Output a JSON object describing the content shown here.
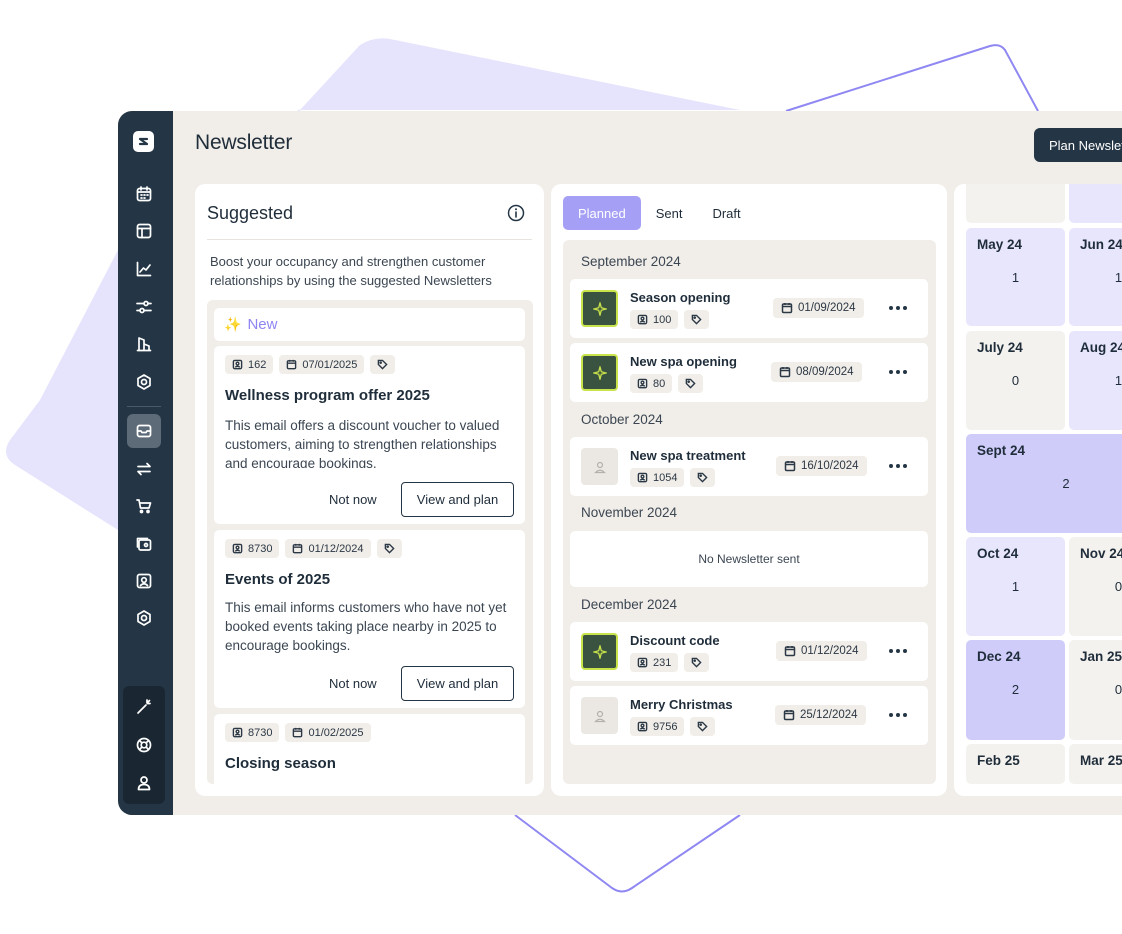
{
  "app": {
    "title": "Newsletter",
    "plan_button": "Plan Newsletter"
  },
  "sidebar": {
    "logo": "brand-logo-icon",
    "items": [
      {
        "icon": "calendar-icon",
        "active": false
      },
      {
        "icon": "layout-icon",
        "active": false
      },
      {
        "icon": "chart-icon",
        "active": false
      },
      {
        "icon": "sliders-icon",
        "active": false
      },
      {
        "icon": "building-icon",
        "active": false
      },
      {
        "icon": "settings-icon",
        "active": false
      },
      {
        "icon": "mail-icon",
        "active": true
      },
      {
        "icon": "transfer-icon",
        "active": false
      },
      {
        "icon": "cart-icon",
        "active": false
      },
      {
        "icon": "wallet-icon",
        "active": false
      },
      {
        "icon": "contact-icon",
        "active": false
      },
      {
        "icon": "gear-icon",
        "active": false
      }
    ],
    "bottom": [
      "magic-wand-icon",
      "lifebuoy-icon",
      "user-icon"
    ]
  },
  "suggested": {
    "title": "Suggested",
    "description": "Boost your occupancy and strengthen customer relationships by using the suggested Newsletters",
    "new_label": "New",
    "cards": [
      {
        "audience": "162",
        "date": "07/01/2025",
        "title": "Wellness program offer 2025",
        "description": "This email offers a discount voucher to valued customers, aiming to strengthen relationships and encourage bookings.",
        "dismiss": "Not now",
        "action": "View and plan"
      },
      {
        "audience": "8730",
        "date": "01/12/2024",
        "title": "Events of 2025",
        "description": "This email informs customers who have not yet booked events taking place nearby in 2025 to encourage bookings.",
        "dismiss": "Not now",
        "action": "View and plan"
      },
      {
        "audience": "8730",
        "date": "01/02/2025",
        "title": "Closing season"
      }
    ]
  },
  "planned": {
    "tabs": [
      "Planned",
      "Sent",
      "Draft"
    ],
    "active_tab": "Planned",
    "months": [
      {
        "label": "September 2024",
        "items": [
          {
            "title": "Season opening",
            "audience": "100",
            "date": "01/09/2024",
            "thumb": "spark"
          },
          {
            "title": "New spa opening",
            "audience": "80",
            "date": "08/09/2024",
            "thumb": "spark"
          }
        ]
      },
      {
        "label": "October 2024",
        "items": [
          {
            "title": "New spa treatment",
            "audience": "1054",
            "date": "16/10/2024",
            "thumb": "plain"
          }
        ]
      },
      {
        "label": "November 2024",
        "empty": "No Newsletter sent"
      },
      {
        "label": "December 2024",
        "items": [
          {
            "title": "Discount code",
            "audience": "231",
            "date": "01/12/2024",
            "thumb": "spark"
          },
          {
            "title": "Merry Christmas",
            "audience": "9756",
            "date": "25/12/2024",
            "thumb": "plain"
          }
        ]
      }
    ]
  },
  "calendar": {
    "months": [
      {
        "name": "May 24",
        "count": "1"
      },
      {
        "name": "Jun 24",
        "count": "1"
      },
      {
        "name": "July 24",
        "count": "0"
      },
      {
        "name": "Aug 24",
        "count": "1"
      },
      {
        "name": "Sept 24",
        "count": "2"
      },
      {
        "name": "Oct 24",
        "count": "1"
      },
      {
        "name": "Nov 24",
        "count": "0"
      },
      {
        "name": "Dec 24",
        "count": "2"
      },
      {
        "name": "Jan 25",
        "count": "0"
      },
      {
        "name": "Feb 25",
        "count": ""
      },
      {
        "name": "Mar 25",
        "count": ""
      }
    ]
  },
  "colors": {
    "sidebar": "#243645",
    "background": "#f1ede8",
    "accent": "#a5a0f5",
    "spark_bg": "#3a5340",
    "spark_border": "#c9e34a"
  }
}
